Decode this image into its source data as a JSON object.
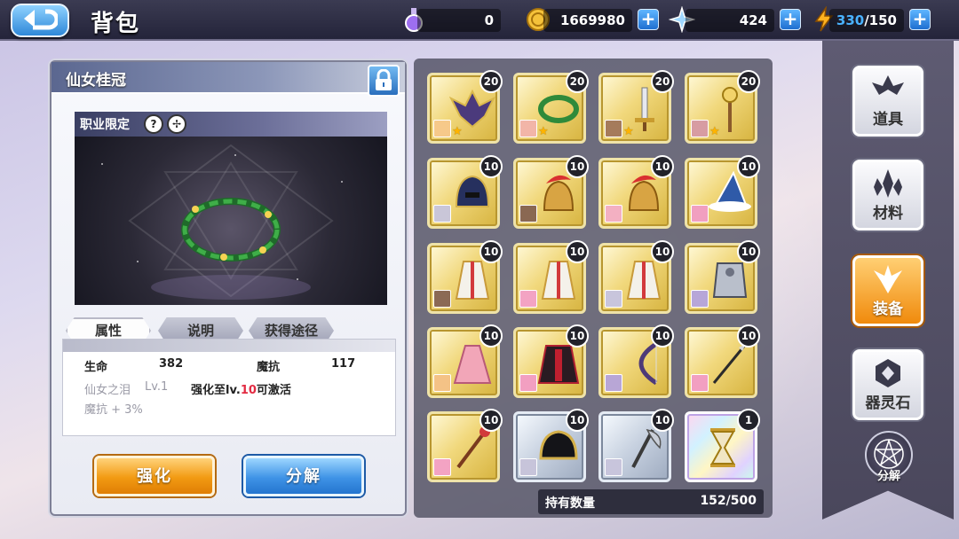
{
  "header": {
    "title": "背包",
    "resources": [
      {
        "name": "potion",
        "icon": "potion-icon",
        "value": "0",
        "has_plus": false
      },
      {
        "name": "gold",
        "icon": "coin-icon",
        "value": "1669980",
        "has_plus": true
      },
      {
        "name": "crystal",
        "icon": "crystal-star-icon",
        "value": "424",
        "has_plus": true
      },
      {
        "name": "stamina",
        "icon": "lightning-icon",
        "value_current": "330",
        "value_max": "/150",
        "has_plus": true
      }
    ],
    "plus_label": "+"
  },
  "detail": {
    "item_name": "仙女桂冠",
    "class_restriction": "职业限定",
    "class_icons": [
      "?",
      "✢"
    ],
    "tabs": [
      "属性",
      "说明",
      "获得途径"
    ],
    "stats": {
      "hp_label": "生命",
      "hp_value": "382",
      "mres_label": "魔抗",
      "mres_value": "117",
      "set_name": "仙女之泪",
      "set_level": "Lv.1",
      "unlock_prefix": "强化至lv.",
      "unlock_level": "10",
      "unlock_suffix": "可激活",
      "bonus": "魔抗 + 3%"
    },
    "enhance_label": "强化",
    "decompose_label": "分解"
  },
  "inventory": {
    "count_label": "持有数量",
    "count_value": "152/500",
    "items": [
      {
        "name": "bat-wing-crown",
        "count": "20",
        "rarity": "gold",
        "star": true,
        "portrait": "#f6c98a"
      },
      {
        "name": "laurel-wreath",
        "count": "20",
        "rarity": "gold",
        "star": true,
        "portrait": "#f2b5a8"
      },
      {
        "name": "short-sword",
        "count": "20",
        "rarity": "gold",
        "star": true,
        "portrait": "#a57b5b"
      },
      {
        "name": "staff",
        "count": "20",
        "rarity": "gold",
        "star": true,
        "portrait": "#d79ca2"
      },
      {
        "name": "dark-helmet",
        "count": "10",
        "rarity": "gold",
        "star": false,
        "portrait": "#c9c6d8"
      },
      {
        "name": "red-plume-helmet",
        "count": "10",
        "rarity": "gold",
        "star": false,
        "portrait": "#8a6852"
      },
      {
        "name": "red-plume-helmet",
        "count": "10",
        "rarity": "gold",
        "star": false,
        "portrait": "#f3b0c2"
      },
      {
        "name": "wizard-hat",
        "count": "10",
        "rarity": "gold",
        "star": false,
        "portrait": "#f19fc0"
      },
      {
        "name": "white-robe",
        "count": "10",
        "rarity": "gold",
        "star": false,
        "portrait": "#8b6a55"
      },
      {
        "name": "white-robe",
        "count": "10",
        "rarity": "gold",
        "star": false,
        "portrait": "#f3a3c3"
      },
      {
        "name": "white-robe",
        "count": "10",
        "rarity": "gold",
        "star": false,
        "portrait": "#c8c5dc"
      },
      {
        "name": "silver-armor",
        "count": "10",
        "rarity": "gold",
        "star": false,
        "portrait": "#b7a6d8"
      },
      {
        "name": "pink-dress",
        "count": "10",
        "rarity": "gold",
        "star": false,
        "portrait": "#f4c286"
      },
      {
        "name": "dark-cape",
        "count": "10",
        "rarity": "gold",
        "star": false,
        "portrait": "#f29fc1"
      },
      {
        "name": "bow",
        "count": "10",
        "rarity": "gold",
        "star": false,
        "portrait": "#b8a6d6"
      },
      {
        "name": "spear",
        "count": "10",
        "rarity": "gold",
        "star": false,
        "portrait": "#f29fc1"
      },
      {
        "name": "red-staff",
        "count": "10",
        "rarity": "gold",
        "star": false,
        "portrait": "#f3a3c3"
      },
      {
        "name": "black-gold-helmet",
        "count": "10",
        "rarity": "silver",
        "star": false,
        "portrait": "#c7c4da"
      },
      {
        "name": "battle-axe",
        "count": "10",
        "rarity": "silver",
        "star": false,
        "portrait": "#c8c5dc"
      },
      {
        "name": "hourglass",
        "count": "1",
        "rarity": "rainbow",
        "star": false,
        "portrait": null
      }
    ]
  },
  "nav": {
    "items": [
      "道具",
      "材料",
      "装备",
      "器灵石"
    ],
    "active_index": 2,
    "decompose_label": "分解"
  },
  "colors": {
    "accent_orange": "#f29a12",
    "accent_blue": "#3f93e6",
    "highlight_red": "#e22b42",
    "stamina_blue": "#4ab2ff"
  }
}
